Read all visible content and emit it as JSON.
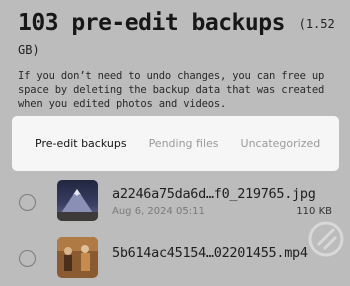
{
  "header": {
    "title": "103 pre-edit backups",
    "size_open": "(1.52",
    "size_close": "GB)",
    "description": "If you don’t need to undo changes, you can free up space by deleting the backup data that was created when you edited photos and videos."
  },
  "tabs": [
    {
      "label": "Pre-edit backups",
      "active": true
    },
    {
      "label": "Pending files",
      "active": false
    },
    {
      "label": "Uncategorized",
      "active": false
    }
  ],
  "files": [
    {
      "name": "a2246a75da6d…f0_219765.jpg",
      "date": "Aug 6, 2024 05:11",
      "size": "110 KB",
      "thumb_icon": "mountain-photo"
    },
    {
      "name": "5b614ac45154…02201455.mp4",
      "date": "",
      "size": "",
      "thumb_icon": "people-video"
    }
  ],
  "watermark_icon": "logo-watermark-icon"
}
